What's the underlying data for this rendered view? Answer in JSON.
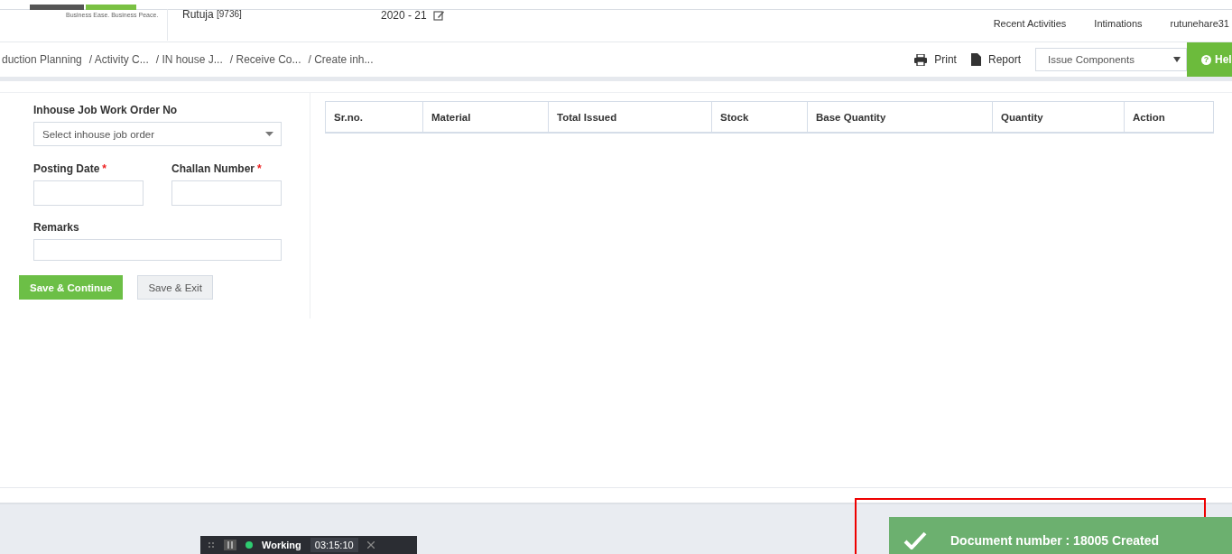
{
  "header": {
    "tagline": "Business Ease. Business Peace.",
    "user": "Rutuja",
    "user_code": "[9736]",
    "fiscal_year": "2020 - 21",
    "nav": [
      {
        "label": "Recent Activities"
      },
      {
        "label": "Intimations"
      },
      {
        "label": "rutunehare31"
      }
    ]
  },
  "breadcrumb": [
    "duction Planning",
    "/ Activity C...",
    "/ IN house J...",
    "/ Receive Co...",
    "/ Create inh..."
  ],
  "toolbar": {
    "print": "Print",
    "report": "Report",
    "select": "Issue Components",
    "help_glyph": "?",
    "help": "Hel"
  },
  "form": {
    "required_mark": "*",
    "job_order": {
      "label": "Inhouse Job Work Order No",
      "placeholder": "Select inhouse job order"
    },
    "posting_date": {
      "label": "Posting Date",
      "required": true
    },
    "challan": {
      "label": "Challan Number",
      "required": true
    },
    "remarks": {
      "label": "Remarks",
      "required": false
    },
    "buttons": [
      {
        "label": "Save & Continue",
        "kind": "primary"
      },
      {
        "label": "Save & Exit",
        "kind": "secondary"
      }
    ]
  },
  "table": {
    "columns": [
      "Sr.no.",
      "Material",
      "Total Issued",
      "Stock",
      "Base Quantity",
      "Quantity",
      "Action"
    ]
  },
  "timer": {
    "status": "Working",
    "time": "03:15:10"
  },
  "toast": {
    "message": "Document number : 18005 Created"
  }
}
